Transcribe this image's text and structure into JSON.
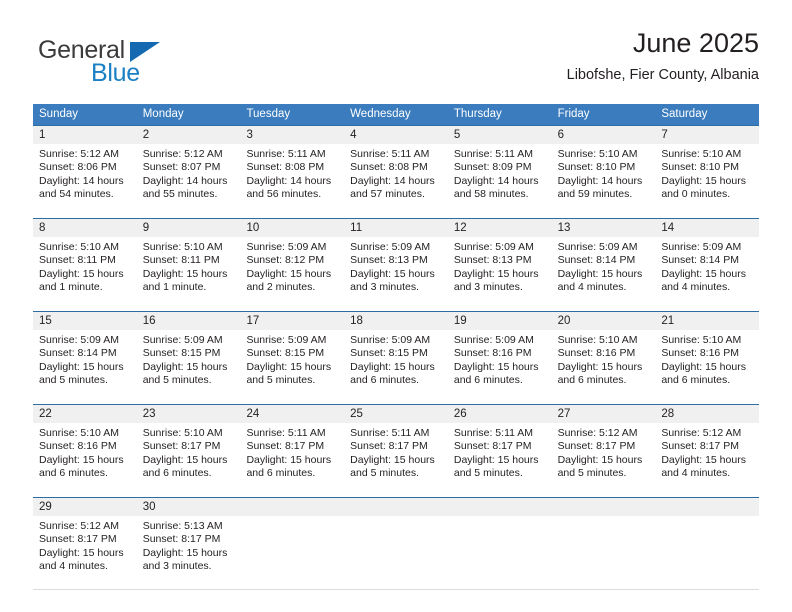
{
  "brand": {
    "word_general": "General",
    "word_blue": "Blue",
    "triangle_color": "#1569b0",
    "blue_color": "#1b7fc4"
  },
  "header": {
    "month_title": "June 2025",
    "location": "Libofshe, Fier County, Albania"
  },
  "theme": {
    "header_blue": "#3a7cbe",
    "row_border_blue": "#2e6da4",
    "date_strip_gray": "#f0f0f0",
    "text_color": "#231f20"
  },
  "weekdays": [
    "Sunday",
    "Monday",
    "Tuesday",
    "Wednesday",
    "Thursday",
    "Friday",
    "Saturday"
  ],
  "weeks": [
    [
      {
        "date": "1",
        "sunrise": "Sunrise: 5:12 AM",
        "sunset": "Sunset: 8:06 PM",
        "daylight_1": "Daylight: 14 hours",
        "daylight_2": "and 54 minutes."
      },
      {
        "date": "2",
        "sunrise": "Sunrise: 5:12 AM",
        "sunset": "Sunset: 8:07 PM",
        "daylight_1": "Daylight: 14 hours",
        "daylight_2": "and 55 minutes."
      },
      {
        "date": "3",
        "sunrise": "Sunrise: 5:11 AM",
        "sunset": "Sunset: 8:08 PM",
        "daylight_1": "Daylight: 14 hours",
        "daylight_2": "and 56 minutes."
      },
      {
        "date": "4",
        "sunrise": "Sunrise: 5:11 AM",
        "sunset": "Sunset: 8:08 PM",
        "daylight_1": "Daylight: 14 hours",
        "daylight_2": "and 57 minutes."
      },
      {
        "date": "5",
        "sunrise": "Sunrise: 5:11 AM",
        "sunset": "Sunset: 8:09 PM",
        "daylight_1": "Daylight: 14 hours",
        "daylight_2": "and 58 minutes."
      },
      {
        "date": "6",
        "sunrise": "Sunrise: 5:10 AM",
        "sunset": "Sunset: 8:10 PM",
        "daylight_1": "Daylight: 14 hours",
        "daylight_2": "and 59 minutes."
      },
      {
        "date": "7",
        "sunrise": "Sunrise: 5:10 AM",
        "sunset": "Sunset: 8:10 PM",
        "daylight_1": "Daylight: 15 hours",
        "daylight_2": "and 0 minutes."
      }
    ],
    [
      {
        "date": "8",
        "sunrise": "Sunrise: 5:10 AM",
        "sunset": "Sunset: 8:11 PM",
        "daylight_1": "Daylight: 15 hours",
        "daylight_2": "and 1 minute."
      },
      {
        "date": "9",
        "sunrise": "Sunrise: 5:10 AM",
        "sunset": "Sunset: 8:11 PM",
        "daylight_1": "Daylight: 15 hours",
        "daylight_2": "and 1 minute."
      },
      {
        "date": "10",
        "sunrise": "Sunrise: 5:09 AM",
        "sunset": "Sunset: 8:12 PM",
        "daylight_1": "Daylight: 15 hours",
        "daylight_2": "and 2 minutes."
      },
      {
        "date": "11",
        "sunrise": "Sunrise: 5:09 AM",
        "sunset": "Sunset: 8:13 PM",
        "daylight_1": "Daylight: 15 hours",
        "daylight_2": "and 3 minutes."
      },
      {
        "date": "12",
        "sunrise": "Sunrise: 5:09 AM",
        "sunset": "Sunset: 8:13 PM",
        "daylight_1": "Daylight: 15 hours",
        "daylight_2": "and 3 minutes."
      },
      {
        "date": "13",
        "sunrise": "Sunrise: 5:09 AM",
        "sunset": "Sunset: 8:14 PM",
        "daylight_1": "Daylight: 15 hours",
        "daylight_2": "and 4 minutes."
      },
      {
        "date": "14",
        "sunrise": "Sunrise: 5:09 AM",
        "sunset": "Sunset: 8:14 PM",
        "daylight_1": "Daylight: 15 hours",
        "daylight_2": "and 4 minutes."
      }
    ],
    [
      {
        "date": "15",
        "sunrise": "Sunrise: 5:09 AM",
        "sunset": "Sunset: 8:14 PM",
        "daylight_1": "Daylight: 15 hours",
        "daylight_2": "and 5 minutes."
      },
      {
        "date": "16",
        "sunrise": "Sunrise: 5:09 AM",
        "sunset": "Sunset: 8:15 PM",
        "daylight_1": "Daylight: 15 hours",
        "daylight_2": "and 5 minutes."
      },
      {
        "date": "17",
        "sunrise": "Sunrise: 5:09 AM",
        "sunset": "Sunset: 8:15 PM",
        "daylight_1": "Daylight: 15 hours",
        "daylight_2": "and 5 minutes."
      },
      {
        "date": "18",
        "sunrise": "Sunrise: 5:09 AM",
        "sunset": "Sunset: 8:15 PM",
        "daylight_1": "Daylight: 15 hours",
        "daylight_2": "and 6 minutes."
      },
      {
        "date": "19",
        "sunrise": "Sunrise: 5:09 AM",
        "sunset": "Sunset: 8:16 PM",
        "daylight_1": "Daylight: 15 hours",
        "daylight_2": "and 6 minutes."
      },
      {
        "date": "20",
        "sunrise": "Sunrise: 5:10 AM",
        "sunset": "Sunset: 8:16 PM",
        "daylight_1": "Daylight: 15 hours",
        "daylight_2": "and 6 minutes."
      },
      {
        "date": "21",
        "sunrise": "Sunrise: 5:10 AM",
        "sunset": "Sunset: 8:16 PM",
        "daylight_1": "Daylight: 15 hours",
        "daylight_2": "and 6 minutes."
      }
    ],
    [
      {
        "date": "22",
        "sunrise": "Sunrise: 5:10 AM",
        "sunset": "Sunset: 8:16 PM",
        "daylight_1": "Daylight: 15 hours",
        "daylight_2": "and 6 minutes."
      },
      {
        "date": "23",
        "sunrise": "Sunrise: 5:10 AM",
        "sunset": "Sunset: 8:17 PM",
        "daylight_1": "Daylight: 15 hours",
        "daylight_2": "and 6 minutes."
      },
      {
        "date": "24",
        "sunrise": "Sunrise: 5:11 AM",
        "sunset": "Sunset: 8:17 PM",
        "daylight_1": "Daylight: 15 hours",
        "daylight_2": "and 6 minutes."
      },
      {
        "date": "25",
        "sunrise": "Sunrise: 5:11 AM",
        "sunset": "Sunset: 8:17 PM",
        "daylight_1": "Daylight: 15 hours",
        "daylight_2": "and 5 minutes."
      },
      {
        "date": "26",
        "sunrise": "Sunrise: 5:11 AM",
        "sunset": "Sunset: 8:17 PM",
        "daylight_1": "Daylight: 15 hours",
        "daylight_2": "and 5 minutes."
      },
      {
        "date": "27",
        "sunrise": "Sunrise: 5:12 AM",
        "sunset": "Sunset: 8:17 PM",
        "daylight_1": "Daylight: 15 hours",
        "daylight_2": "and 5 minutes."
      },
      {
        "date": "28",
        "sunrise": "Sunrise: 5:12 AM",
        "sunset": "Sunset: 8:17 PM",
        "daylight_1": "Daylight: 15 hours",
        "daylight_2": "and 4 minutes."
      }
    ],
    [
      {
        "date": "29",
        "sunrise": "Sunrise: 5:12 AM",
        "sunset": "Sunset: 8:17 PM",
        "daylight_1": "Daylight: 15 hours",
        "daylight_2": "and 4 minutes."
      },
      {
        "date": "30",
        "sunrise": "Sunrise: 5:13 AM",
        "sunset": "Sunset: 8:17 PM",
        "daylight_1": "Daylight: 15 hours",
        "daylight_2": "and 3 minutes."
      },
      {
        "date": "",
        "sunrise": "",
        "sunset": "",
        "daylight_1": "",
        "daylight_2": ""
      },
      {
        "date": "",
        "sunrise": "",
        "sunset": "",
        "daylight_1": "",
        "daylight_2": ""
      },
      {
        "date": "",
        "sunrise": "",
        "sunset": "",
        "daylight_1": "",
        "daylight_2": ""
      },
      {
        "date": "",
        "sunrise": "",
        "sunset": "",
        "daylight_1": "",
        "daylight_2": ""
      },
      {
        "date": "",
        "sunrise": "",
        "sunset": "",
        "daylight_1": "",
        "daylight_2": ""
      }
    ]
  ]
}
